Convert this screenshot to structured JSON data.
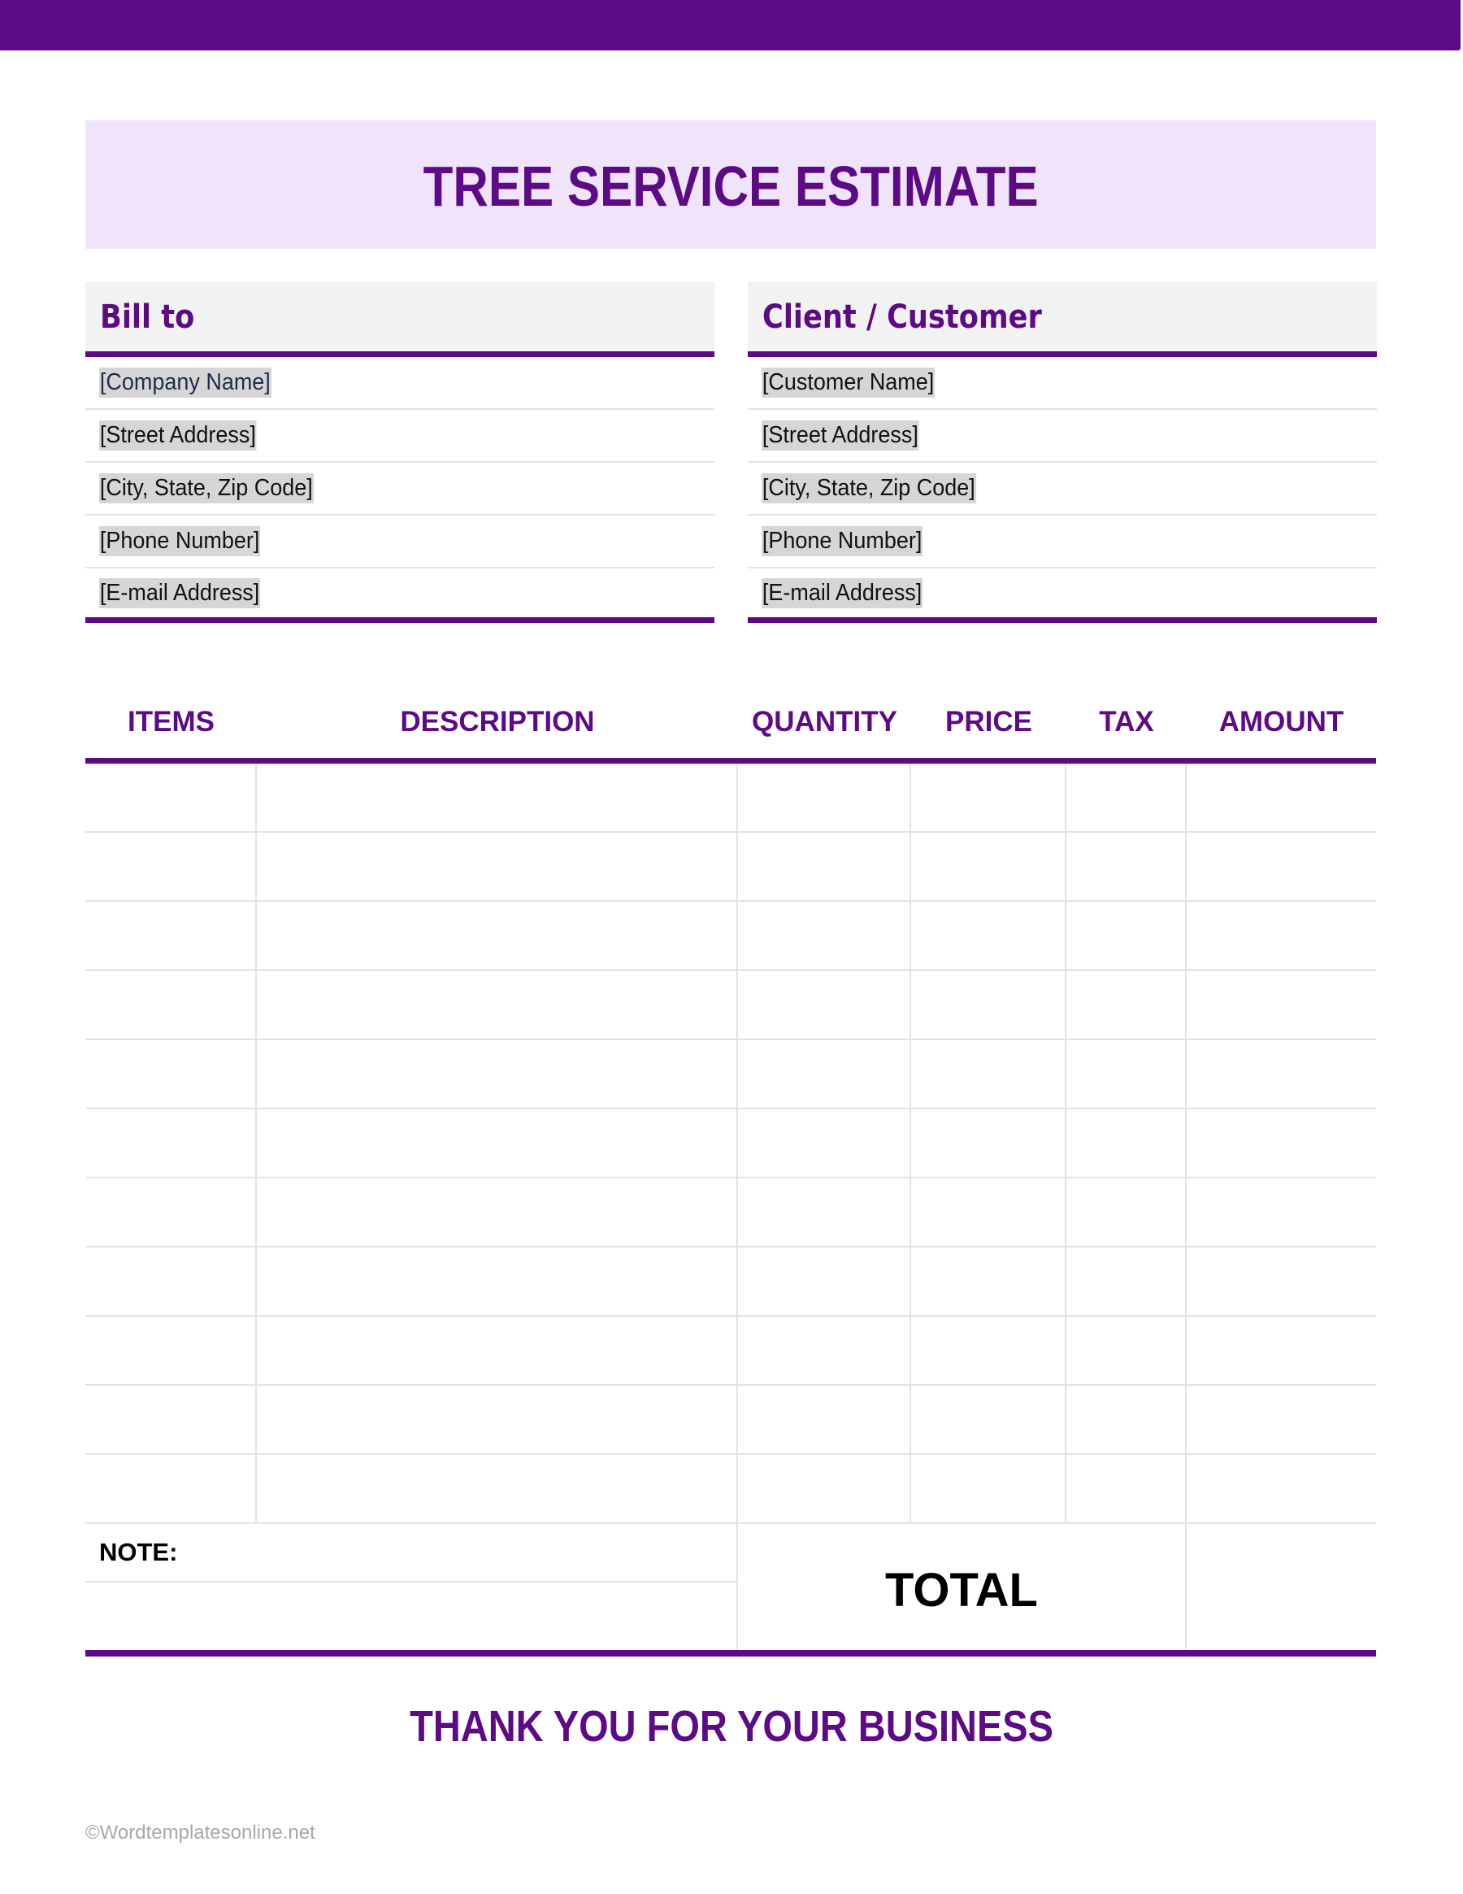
{
  "colors": {
    "brand": "#5c0a86",
    "title_bg": "#f0e4fa",
    "header_bg": "#f2f2f2",
    "placeholder_highlight": "#d6d6d6"
  },
  "title": "TREE SERVICE ESTIMATE",
  "bill_to": {
    "heading": "Bill to",
    "fields": [
      "[Company Name]",
      "[Street Address]",
      "[City, State, Zip Code]",
      "[Phone Number]",
      "[E-mail Address]"
    ]
  },
  "client": {
    "heading": "Client / Customer",
    "fields": [
      "[Customer Name]",
      "[Street Address]",
      "[City, State, Zip Code]",
      "[Phone Number]",
      "[E-mail Address]"
    ]
  },
  "items_table": {
    "columns": [
      "ITEMS",
      "DESCRIPTION",
      "QUANTITY",
      "PRICE",
      "TAX",
      "AMOUNT"
    ],
    "rows": [
      [
        "",
        "",
        "",
        "",
        "",
        ""
      ],
      [
        "",
        "",
        "",
        "",
        "",
        ""
      ],
      [
        "",
        "",
        "",
        "",
        "",
        ""
      ],
      [
        "",
        "",
        "",
        "",
        "",
        ""
      ],
      [
        "",
        "",
        "",
        "",
        "",
        ""
      ],
      [
        "",
        "",
        "",
        "",
        "",
        ""
      ],
      [
        "",
        "",
        "",
        "",
        "",
        ""
      ],
      [
        "",
        "",
        "",
        "",
        "",
        ""
      ],
      [
        "",
        "",
        "",
        "",
        "",
        ""
      ],
      [
        "",
        "",
        "",
        "",
        "",
        ""
      ],
      [
        "",
        "",
        "",
        "",
        "",
        ""
      ]
    ],
    "note_label": "NOTE:",
    "note_value": "",
    "total_label": "TOTAL",
    "total_value": ""
  },
  "footer": {
    "thanks": "THANK YOU FOR YOUR BUSINESS",
    "watermark": "©Wordtemplatesonline.net"
  }
}
